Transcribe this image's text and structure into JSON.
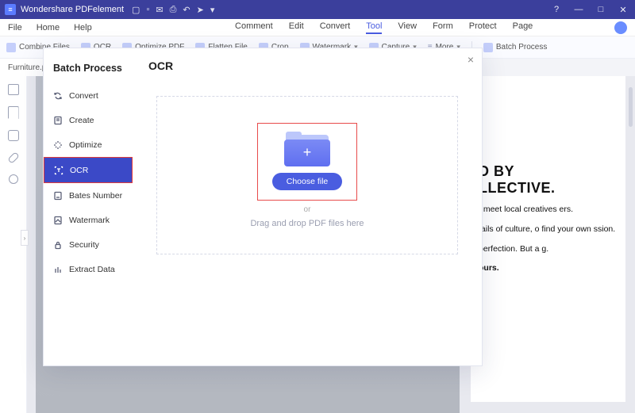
{
  "titlebar": {
    "app_name": "Wondershare PDFelement",
    "quick_icons": [
      "folder-open",
      "file",
      "mail",
      "print",
      "undo",
      "redo",
      "dropdown"
    ],
    "win_buttons": {
      "help": "?",
      "min": "—",
      "max": "□",
      "close": "✕"
    }
  },
  "menubar": {
    "left": [
      "File",
      "Home",
      "Help"
    ],
    "center": [
      "Comment",
      "Edit",
      "Convert",
      "Tool",
      "View",
      "Form",
      "Protect",
      "Page"
    ],
    "active": "Tool"
  },
  "toolbar": {
    "items": [
      "Combine Files",
      "OCR",
      "Optimize PDF",
      "Flatten File",
      "Crop",
      "Watermark",
      "Capture",
      "More"
    ],
    "right_item": "Batch Process"
  },
  "tabs": {
    "open": [
      {
        "label": "Furniture.pdf",
        "close": "×"
      }
    ]
  },
  "left_rail_icons": [
    "page-thumb",
    "bookmark",
    "comment-panel",
    "attachment",
    "search"
  ],
  "document": {
    "heading_line1": "D BY",
    "heading_line2": "LLECTIVE.",
    "p1": ", meet local creatives ers.",
    "p2": "tails of culture, o find your own ssion.",
    "p3": "perfection. But a g.",
    "p4": "ours."
  },
  "modal": {
    "title_side": "Batch Process",
    "title_main": "OCR",
    "close": "×",
    "side_items": [
      {
        "key": "convert",
        "label": "Convert"
      },
      {
        "key": "create",
        "label": "Create"
      },
      {
        "key": "optimize",
        "label": "Optimize"
      },
      {
        "key": "ocr",
        "label": "OCR"
      },
      {
        "key": "bates",
        "label": "Bates Number"
      },
      {
        "key": "watermark",
        "label": "Watermark"
      },
      {
        "key": "security",
        "label": "Security"
      },
      {
        "key": "extract",
        "label": "Extract Data"
      }
    ],
    "active_key": "ocr",
    "dropzone": {
      "button": "Choose file",
      "or": "or",
      "hint": "Drag and drop PDF files here",
      "folder_plus": "+"
    }
  }
}
